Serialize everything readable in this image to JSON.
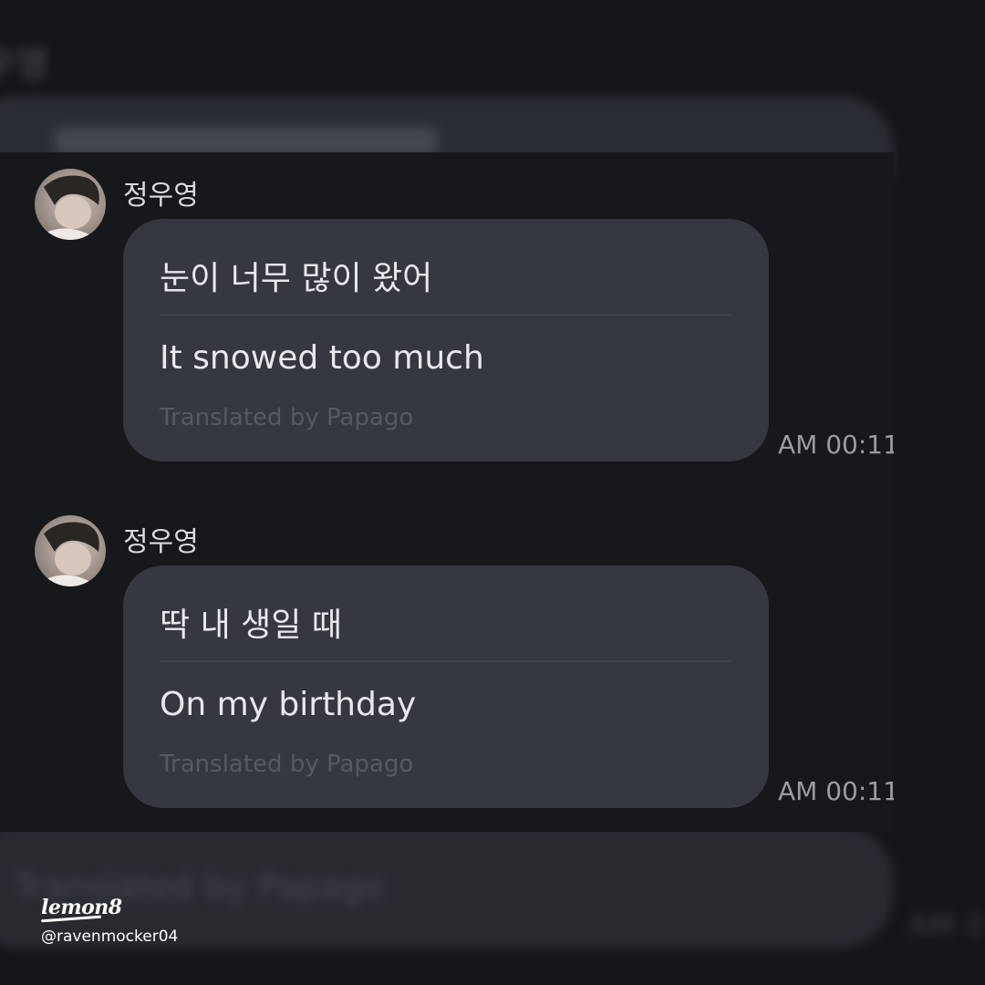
{
  "background": {
    "top_name": "우영",
    "bottom_credit": "Translated by Papago",
    "bottom_time": "AM 0"
  },
  "messages": [
    {
      "sender": "정우영",
      "original": "눈이 너무 많이 왔어",
      "translation": "It snowed too much",
      "credit": "Translated by Papago",
      "time": "AM 00:11"
    },
    {
      "sender": "정우영",
      "original": "딱 내 생일 때",
      "translation": "On my birthday",
      "credit": "Translated by Papago",
      "time": "AM 00:11"
    }
  ],
  "watermark": {
    "logo_text": "lemon8",
    "handle": "@ravenmocker04"
  },
  "colors": {
    "background": "#141518",
    "bubble": "#35383f",
    "text": "#e8e9ec",
    "muted": "#565961",
    "time": "#9a9ca3"
  }
}
